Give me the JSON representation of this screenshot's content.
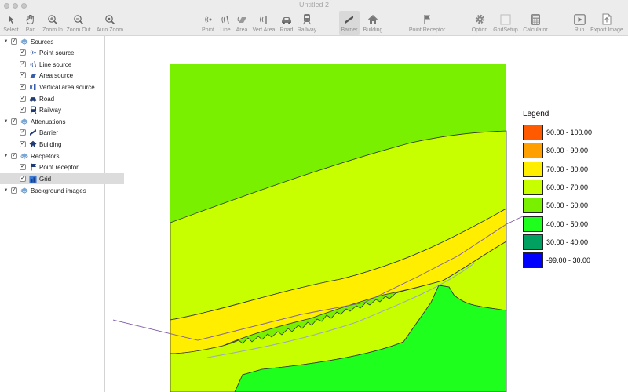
{
  "window": {
    "title": "Untitled 2"
  },
  "toolbar": {
    "select": "Select",
    "pan": "Pan",
    "zoom_in": "Zoom In",
    "zoom_out": "Zoom Out",
    "auto_zoom": "Auto Zoom",
    "point": "Point",
    "line": "Line",
    "area": "Area",
    "vert_area": "Vert Area",
    "road": "Road",
    "railway": "Railway",
    "barrier": "Barrier",
    "building": "Building",
    "point_receptor": "Point Receptor",
    "option": "Option",
    "grid_setup": "GridSetup",
    "calculator": "Calculator",
    "run": "Run",
    "export_image": "Export Image"
  },
  "tree": {
    "sources": "Sources",
    "point_source": "Point source",
    "line_source": "Line source",
    "area_source": "Area source",
    "vertical_area_source": "Vertical area source",
    "road": "Road",
    "railway": "Railway",
    "attenuations": "Attenuations",
    "barrier": "Barrier",
    "building": "Building",
    "receptors": "Recpetors",
    "point_receptor": "Point receptor",
    "grid": "Grid",
    "background_images": "Background images",
    "checkmark": "✓",
    "expanded": "▼"
  },
  "legend": {
    "title": "Legend",
    "items": [
      {
        "label": "90.00 - 100.00",
        "color": "#ff5a00"
      },
      {
        "label": "80.00 - 90.00",
        "color": "#ffa000"
      },
      {
        "label": "70.00 - 80.00",
        "color": "#ffee00"
      },
      {
        "label": "60.00 - 70.00",
        "color": "#c8ff00"
      },
      {
        "label": "50.00 - 60.00",
        "color": "#78f000"
      },
      {
        "label": "40.00 - 50.00",
        "color": "#1eff1e"
      },
      {
        "label": "30.00 - 40.00",
        "color": "#00a060"
      },
      {
        "label": "-99.00 - 30.00",
        "color": "#0000ff"
      }
    ]
  },
  "colors": {
    "band_50_60": "#78f000",
    "band_60_70": "#c8ff00",
    "band_70_80": "#ffee00",
    "band_40_50": "#1eff1e"
  }
}
